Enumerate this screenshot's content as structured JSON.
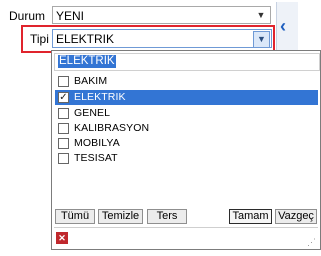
{
  "form": {
    "durum_label": "Durum",
    "durum_value": "YENI",
    "tipi_label": "Tipi",
    "tipi_value": "ELEKTRIK"
  },
  "dropdown": {
    "search_text": "ELEKTRIK",
    "items": [
      {
        "label": "BAKIM",
        "checked": false,
        "selected": false
      },
      {
        "label": "ELEKTRIK",
        "checked": true,
        "selected": true
      },
      {
        "label": "GENEL",
        "checked": false,
        "selected": false
      },
      {
        "label": "KALIBRASYON",
        "checked": false,
        "selected": false
      },
      {
        "label": "MOBILYA",
        "checked": false,
        "selected": false
      },
      {
        "label": "TESISAT",
        "checked": false,
        "selected": false
      }
    ],
    "buttons": {
      "all": "Tümü",
      "clear": "Temizle",
      "invert": "Ters",
      "ok": "Tamam",
      "cancel": "Vazgeç"
    }
  },
  "icons": {
    "dropdown_arrow": "chevron-down-icon",
    "side_toggle": "chevron-left-icon",
    "close": "close-icon",
    "resize": "resize-grip-icon"
  },
  "colors": {
    "highlight_frame": "#e0242d",
    "selection": "#3375d4",
    "close_button": "#c0282d"
  }
}
